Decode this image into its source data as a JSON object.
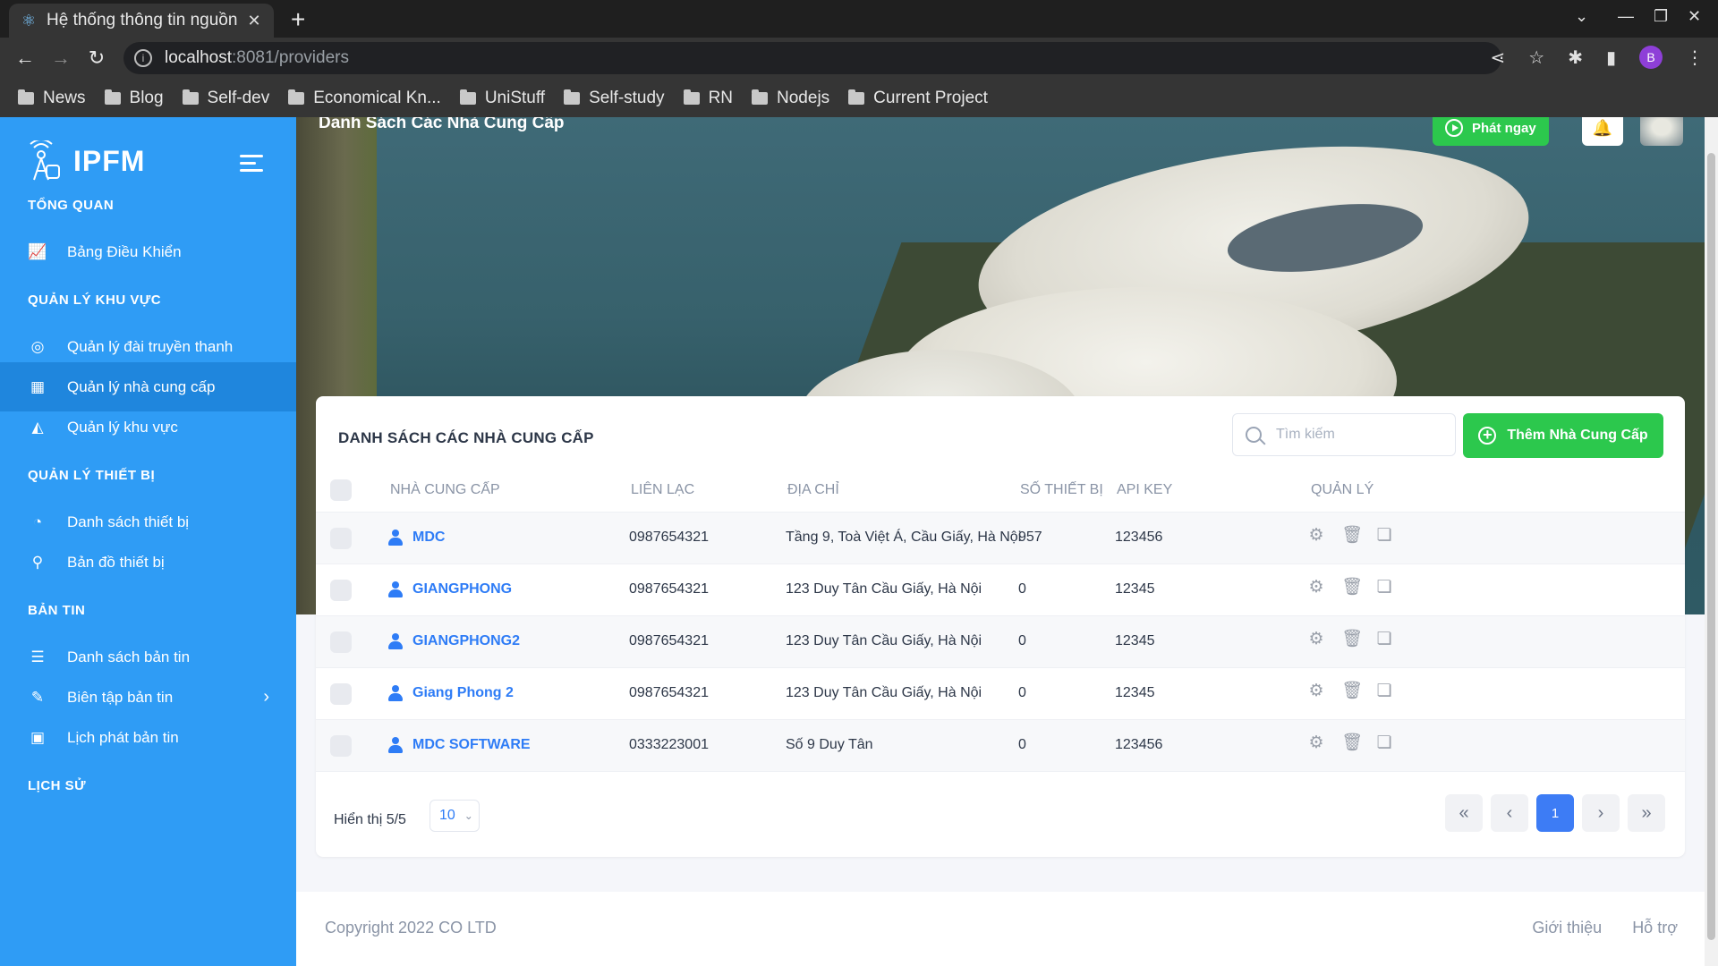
{
  "browser": {
    "tab_title": "Hệ thống thông tin nguồn",
    "url_host": "localhost",
    "url_path": ":8081/providers",
    "profile_initial": "B",
    "bookmarks": [
      "News",
      "Blog",
      "Self-dev",
      "Economical Kn...",
      "UniStuff",
      "Self-study",
      "RN",
      "Nodejs",
      "Current Project"
    ]
  },
  "sidebar": {
    "brand": "IPFM",
    "sections": [
      {
        "title": "TỔNG QUAN",
        "items": [
          {
            "label": "Bảng Điều Khiển",
            "icon": "chart-icon"
          }
        ]
      },
      {
        "title": "QUẢN LÝ KHU VỰC",
        "items": [
          {
            "label": "Quản lý đài truyền thanh",
            "icon": "radio-icon"
          },
          {
            "label": "Quản lý nhà cung cấp",
            "icon": "provider-icon",
            "active": true
          },
          {
            "label": "Quản lý khu vực",
            "icon": "area-icon"
          }
        ]
      },
      {
        "title": "QUẢN LÝ THIẾT BỊ",
        "items": [
          {
            "label": "Danh sách thiết bị",
            "icon": "device-icon"
          },
          {
            "label": "Bản đồ thiết bị",
            "icon": "map-icon"
          }
        ]
      },
      {
        "title": "BẢN TIN",
        "items": [
          {
            "label": "Danh sách bản tin",
            "icon": "list-icon"
          },
          {
            "label": "Biên tập bản tin",
            "icon": "edit-icon"
          },
          {
            "label": "Lịch phát bản tin",
            "icon": "calendar-icon"
          }
        ]
      },
      {
        "title": "LỊCH SỬ",
        "items": []
      }
    ]
  },
  "header": {
    "page_title": "Danh Sách Các Nhà Cung Cấp",
    "play_label": "Phát ngay"
  },
  "card": {
    "title": "DANH SÁCH CÁC NHÀ CUNG CẤP",
    "search_placeholder": "Tìm kiếm",
    "add_label": "Thêm Nhà Cung Cấp",
    "columns": [
      "NHÀ CUNG CẤP",
      "LIÊN LẠC",
      "ĐỊA CHỈ",
      "SỐ THIẾT BỊ",
      "API KEY",
      "QUẢN LÝ"
    ],
    "rows": [
      {
        "name": "MDC",
        "phone": "0987654321",
        "address": "Tầng 9, Toà Việt Á, Cầu Giấy, Hà Nội",
        "devices": "957",
        "api_key": "123456"
      },
      {
        "name": "GIANGPHONG",
        "phone": "0987654321",
        "address": "123 Duy Tân Cầu Giấy, Hà Nội",
        "devices": "0",
        "api_key": "12345"
      },
      {
        "name": "GIANGPHONG2",
        "phone": "0987654321",
        "address": "123 Duy Tân Cầu Giấy, Hà Nội",
        "devices": "0",
        "api_key": "12345"
      },
      {
        "name": "Giang Phong 2",
        "phone": "0987654321",
        "address": "123 Duy Tân Cầu Giấy, Hà Nội",
        "devices": "0",
        "api_key": "12345"
      },
      {
        "name": "MDC SOFTWARE",
        "phone": "0333223001",
        "address": "Số 9 Duy Tân",
        "devices": "0",
        "api_key": "123456"
      }
    ],
    "showing": "Hiển thị 5/5",
    "page_size": "10",
    "current_page": "1"
  },
  "footer": {
    "copyright": "Copyright 2022 CO LTD",
    "links": [
      "Giới thiệu",
      "Hỗ trợ"
    ]
  }
}
